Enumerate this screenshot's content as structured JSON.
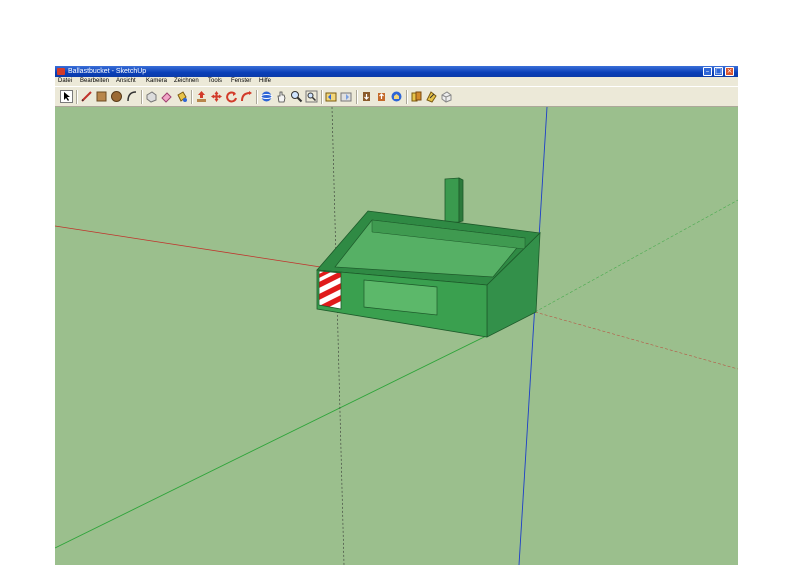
{
  "window": {
    "title": "Ballastbucket - SketchUp",
    "controls": [
      "minimize",
      "maximize",
      "close"
    ]
  },
  "menu": {
    "items": [
      "Datei",
      "Bearbeiten",
      "Ansicht",
      "Kamera",
      "Zeichnen",
      "Tools",
      "Fenster",
      "Hilfe"
    ]
  },
  "toolbar": {
    "tools": [
      "select-tool-icon",
      "pencil-line-icon",
      "rectangle-icon",
      "circle-icon",
      "arc-icon",
      "make-component-icon",
      "eraser-icon",
      "paint-bucket-icon",
      "push-pull-icon",
      "move-icon",
      "rotate-icon",
      "follow-me-icon",
      "orbit-icon",
      "pan-icon",
      "zoom-icon",
      "zoom-extents-icon",
      "previous-view-icon",
      "next-view-icon",
      "get-models-icon",
      "share-model-icon",
      "components-icon",
      "materials-icon",
      "styles-icon",
      "layers-icon"
    ]
  },
  "scene": {
    "background_color": "#9bbf8d",
    "model_color": "#3a9a4e",
    "warning_stripe_colors": [
      "#e01b1b",
      "#ffffff"
    ],
    "axes": {
      "red": "#c0322b",
      "green": "#2ea43a",
      "blue": "#1d3fc8"
    }
  }
}
